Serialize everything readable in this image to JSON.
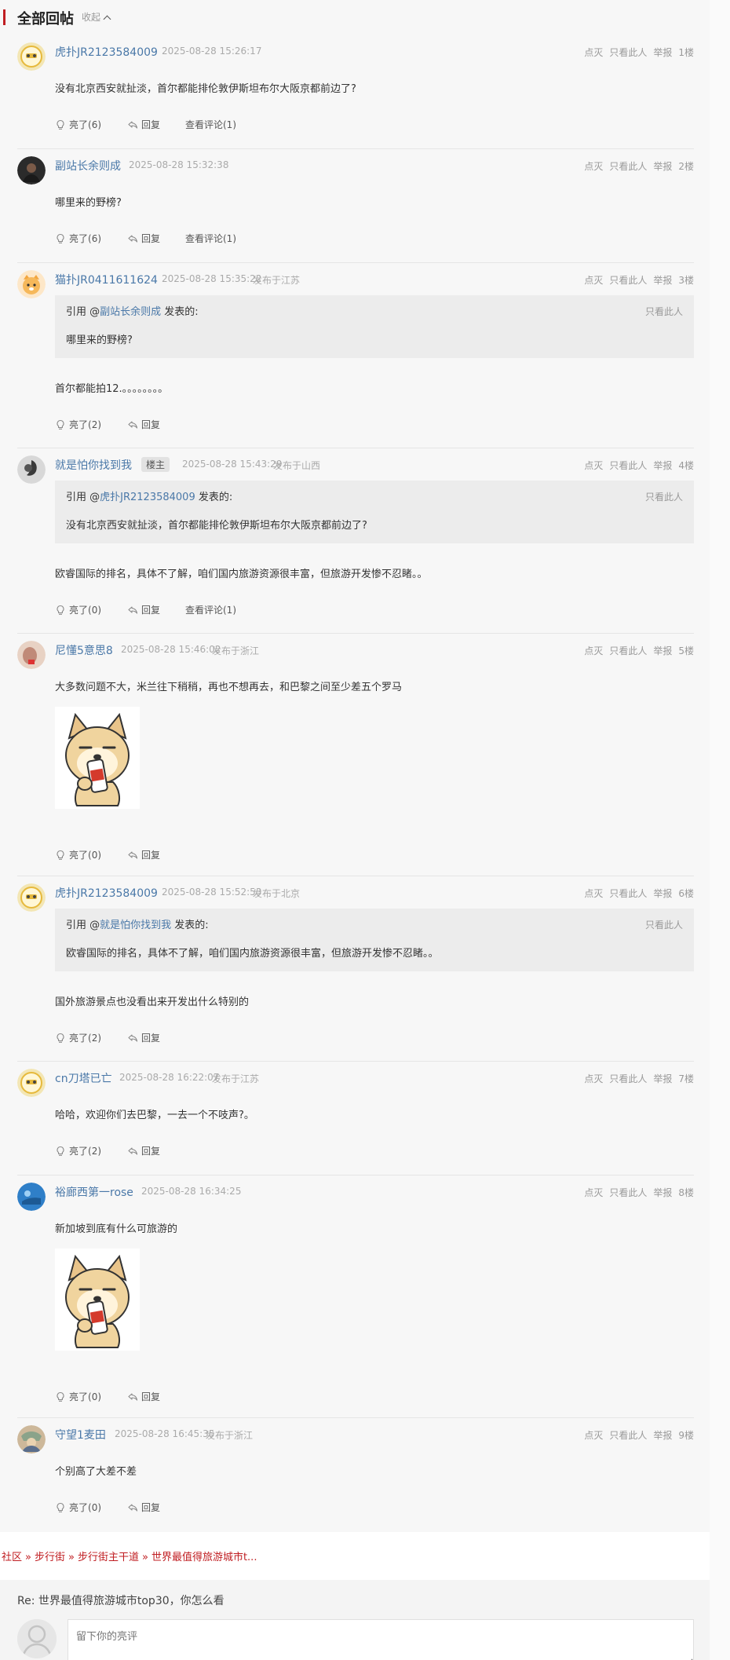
{
  "header": {
    "title": "全部回帖",
    "collapse_label": "收起"
  },
  "only_label": "只看此人",
  "actions": {
    "like": "亮了",
    "reply": "回复",
    "quote_intro": "引用 @",
    "quote_suffix": " 发表的:"
  },
  "posts": [
    {
      "user": "虎扑JR2123584009",
      "time": "2025-08-28 15:26:17",
      "location": "",
      "badge": "",
      "dislike": "点灭",
      "only": "只看此人",
      "report": "举报",
      "floor": "1楼",
      "text": "没有北京西安就扯淡，首尔都能排伦敦伊斯坦布尔大阪京都前边了?",
      "likes": "(6)",
      "view_comments": "查看评论(1)"
    },
    {
      "user": "副站长余则成",
      "time": "2025-08-28 15:32:38",
      "location": "",
      "badge": "",
      "dislike": "点灭",
      "only": "只看此人",
      "report": "举报",
      "floor": "2楼",
      "text": "哪里来的野榜?",
      "likes": "(6)",
      "view_comments": "查看评论(1)"
    },
    {
      "user": "猫扑JR0411611624",
      "time": "2025-08-28 15:35:22",
      "location": "发布于江苏",
      "badge": "",
      "dislike": "点灭",
      "only": "只看此人",
      "report": "举报",
      "floor": "3楼",
      "quote_user": "副站长余则成",
      "quote_text": "哪里来的野榜?",
      "text": "首尔都能拍12.。。。。。。。。",
      "likes": "(2)",
      "view_comments": ""
    },
    {
      "user": "就是怕你找到我",
      "time": "2025-08-28 15:43:29",
      "location": "发布于山西",
      "badge": "楼主",
      "dislike": "点灭",
      "only": "只看此人",
      "report": "举报",
      "floor": "4楼",
      "quote_user": "虎扑JR2123584009",
      "quote_text": "没有北京西安就扯淡，首尔都能排伦敦伊斯坦布尔大阪京都前边了?",
      "text": "欧睿国际的排名，具体不了解，咱们国内旅游资源很丰富，但旅游开发惨不忍睹。。",
      "likes": "(0)",
      "view_comments": "查看评论(1)"
    },
    {
      "user": "尼懂5意思8",
      "time": "2025-08-28 15:46:02",
      "location": "发布于浙江",
      "badge": "",
      "dislike": "点灭",
      "only": "只看此人",
      "report": "举报",
      "floor": "5楼",
      "text": "大多数问题不大，米兰往下稍稍，再也不想再去，和巴黎之间至少差五个罗马",
      "likes": "(0)",
      "view_comments": ""
    },
    {
      "user": "虎扑JR2123584009",
      "time": "2025-08-28 15:52:53",
      "location": "发布于北京",
      "badge": "",
      "dislike": "点灭",
      "only": "只看此人",
      "report": "举报",
      "floor": "6楼",
      "quote_user": "就是怕你找到我",
      "quote_text": "欧睿国际的排名，具体不了解，咱们国内旅游资源很丰富，但旅游开发惨不忍睹。。",
      "text": "国外旅游景点也没看出来开发出什么特别的",
      "likes": "(2)",
      "view_comments": ""
    },
    {
      "user": "cn刀塔已亡",
      "time": "2025-08-28 16:22:07",
      "location": "发布于江苏",
      "badge": "",
      "dislike": "点灭",
      "only": "只看此人",
      "report": "举报",
      "floor": "7楼",
      "text": "哈哈，欢迎你们去巴黎，一去一个不吱声?。",
      "likes": "(2)",
      "view_comments": ""
    },
    {
      "user": "裕廊西第一rose",
      "time": "2025-08-28 16:34:25",
      "location": "",
      "badge": "",
      "dislike": "点灭",
      "only": "只看此人",
      "report": "举报",
      "floor": "8楼",
      "text": "新加坡到底有什么可旅游的",
      "likes": "(0)",
      "view_comments": ""
    },
    {
      "user": "守望1麦田",
      "time": "2025-08-28 16:45:35",
      "location": "发布于浙江",
      "badge": "",
      "dislike": "点灭",
      "only": "只看此人",
      "report": "举报",
      "floor": "9楼",
      "text": "个别高了大差不差",
      "likes": "(0)",
      "view_comments": ""
    }
  ],
  "breadcrumb": {
    "items": [
      "社区",
      "步行街",
      "步行街主干道",
      "世界最值得旅游城市t..."
    ],
    "separator": "»"
  },
  "reply": {
    "title": "Re: 世界最值得旅游城市top30，你怎么看",
    "placeholder": "留下你的亮评"
  },
  "colors": {
    "accent": "#c01e22",
    "username": "#4a78a8",
    "background": "#f7f7f7"
  }
}
